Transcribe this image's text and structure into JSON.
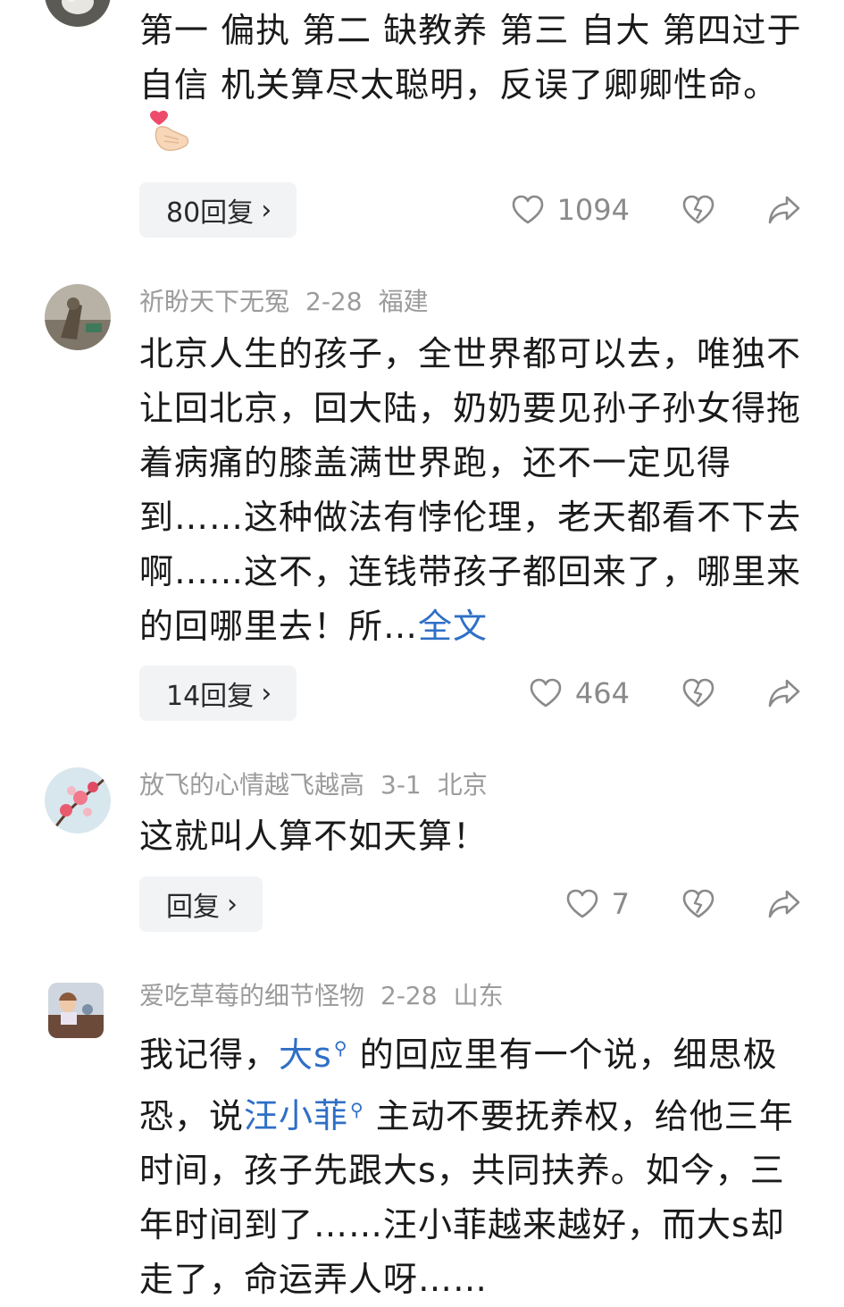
{
  "comments": [
    {
      "text": "第一 偏执 第二 缺教养 第三 自大 第四过于自信 机关算尽太聪明，反误了卿卿性命。",
      "emoji": "heart-hands-icon",
      "reply_label": "80回复",
      "likes": "1094"
    },
    {
      "username": "祈盼天下无冤",
      "date": "2-28",
      "location": "福建",
      "text": "北京人生的孩子，全世界都可以去，唯独不让回北京，回大陆，奶奶要见孙子孙女得拖着病痛的膝盖满世界跑，还不一定见得到……这种做法有悖伦理，老天都看不下去啊……这不，连钱带孩子都回来了，哪里来的回哪里去！所…",
      "expand_label": "全文",
      "reply_label": "14回复",
      "likes": "464"
    },
    {
      "username": "放飞的心情越飞越高",
      "date": "3-1",
      "location": "北京",
      "text": "这就叫人算不如天算！",
      "reply_label": "回复",
      "likes": "7"
    },
    {
      "username": "爱吃草莓的细节怪物",
      "date": "2-28",
      "location": "山东",
      "text_parts": {
        "p1": "我记得，",
        "link1": "大s",
        "p2": " 的回应里有一个说，细思极恐，说",
        "link2": "汪小菲",
        "p3": " 主动不要抚养权，给他三年时间，孩子先跟大s，共同扶养。如今，三年时间到了……汪小菲越来越",
        "p4": "好，而大s却走了，命运弄人呀……"
      }
    }
  ],
  "colors": {
    "text": "#1a1a1a",
    "meta": "#9b9b9b",
    "link": "#2f6fc6",
    "reply_bg": "#f2f3f5",
    "icon": "#8a8a8a"
  }
}
